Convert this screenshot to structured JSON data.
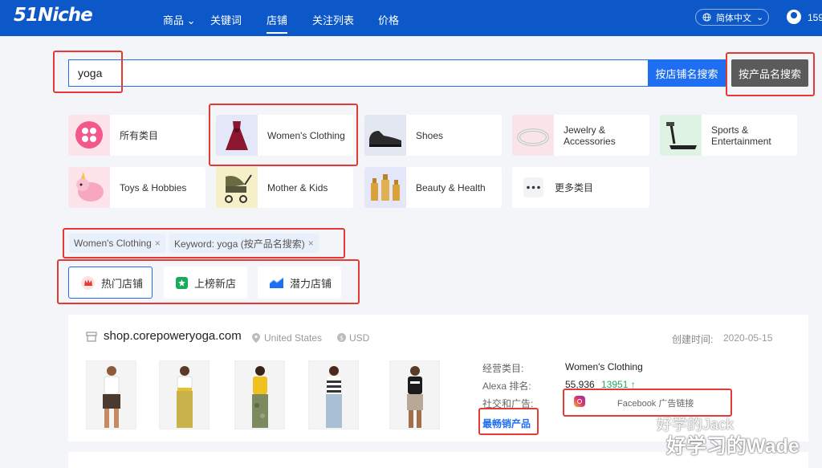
{
  "header": {
    "logo": "51Niche",
    "nav": [
      {
        "label": "商品",
        "chevron": "⌄"
      },
      {
        "label": "关键词"
      },
      {
        "label": "店铺"
      },
      {
        "label": "关注列表"
      },
      {
        "label": "价格"
      }
    ],
    "language": "简体中文",
    "language_chevron": "⌄",
    "phone_prefix": "159"
  },
  "search": {
    "value": "yoga",
    "by_store_label": "按店铺名搜索",
    "by_product_label": "按产品名搜索"
  },
  "categories": [
    {
      "label": "所有类目"
    },
    {
      "label": "Women's Clothing"
    },
    {
      "label": "Shoes"
    },
    {
      "label": "Jewelry &\nAccessories"
    },
    {
      "label": "Sports &\nEntertainment"
    },
    {
      "label": "Toys & Hobbies"
    },
    {
      "label": "Mother & Kids"
    },
    {
      "label": "Beauty & Health"
    },
    {
      "label": "更多类目"
    }
  ],
  "filters": [
    {
      "label": "Women's Clothing",
      "close": "×"
    },
    {
      "label": "Keyword: yoga (按产品名搜索)",
      "close": "×"
    }
  ],
  "store_types": [
    {
      "label": "热门店铺",
      "color": "#e53935"
    },
    {
      "label": "上榜新店",
      "color": "#1aab5a"
    },
    {
      "label": "潜力店铺",
      "color": "#1d6ef0"
    }
  ],
  "store": {
    "name": "shop.corepoweryoga.com",
    "country": "United States",
    "currency": "USD",
    "created_label": "创建时间:",
    "created_date": "2020-05-15",
    "category_label": "经营类目:",
    "category_value": "Women's Clothing",
    "alexa_label": "Alexa 排名:",
    "alexa_value": "55,936",
    "alexa_change": "13951 ↑",
    "social_label": "社交和广告:",
    "facebook_label": "Facebook 广告链接",
    "bestseller_label": "最畅销产品"
  },
  "watermark": {
    "line1": "好学的Jack",
    "line2": "好学习的Wade"
  },
  "colors": {
    "brand": "#0c58c9",
    "primary": "#1d6ef0",
    "highlight": "#e53935"
  }
}
